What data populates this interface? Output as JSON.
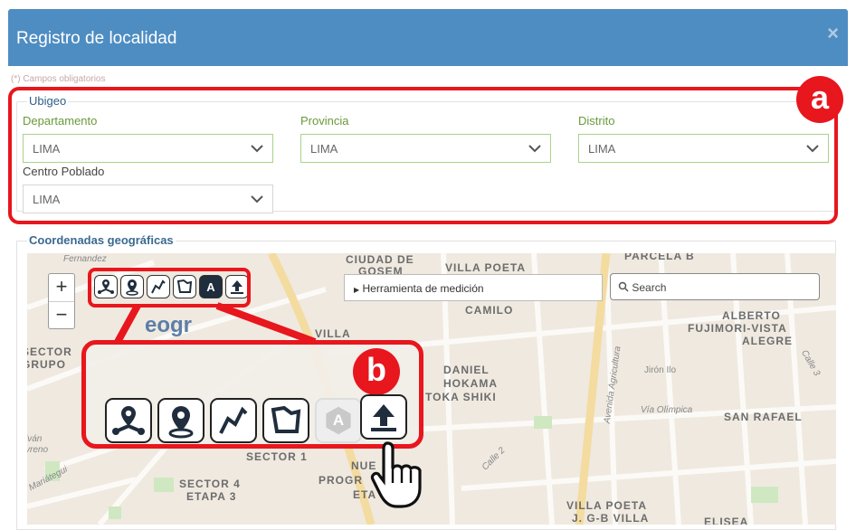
{
  "header": {
    "title": "Registro de localidad",
    "close": "×"
  },
  "required_note": "(*) Campos obligatorios",
  "ubigeo": {
    "legend": "Ubigeo",
    "departamento": {
      "label": "Departamento",
      "value": "LIMA"
    },
    "provincia": {
      "label": "Provincia",
      "value": "LIMA"
    },
    "distrito": {
      "label": "Distrito",
      "value": "LIMA"
    },
    "centro_poblado": {
      "label": "Centro Poblado",
      "value": "LIMA"
    }
  },
  "coords": {
    "legend": "Coordenadas geográficas"
  },
  "map": {
    "zoom_in": "+",
    "zoom_out": "−",
    "measure_label": "Herramienta de medición",
    "search_placeholder": "Search",
    "labels": {
      "fernandez": "Fernandez",
      "ciudad_de": "CIUDAD DE",
      "gosem": "GOSEM",
      "villa_poeta": "VILLA POETA",
      "parcela": "PARCELA B",
      "camilo": "CAMILO",
      "alberto": "ALBERTO",
      "fujimori": "FUJIMORI-VISTA",
      "alegre": "ALEGRE",
      "sector": "SECTOR",
      "grupo": "GRUPO",
      "villa": "VILLA",
      "daniel": "DANIEL",
      "hokama": "HOKAMA",
      "toka": "TOKA SHIKI",
      "av_agricultura": "Avenida Agricultura",
      "jiron_ilo": "Jirón Ilo",
      "calle3": "Calle 3",
      "via_olimpica": "Vía Olímpica",
      "san_rafael": "SAN RAFAEL",
      "sector1": "SECTOR 1",
      "calle2": "Calle 2",
      "mariategui": "Mariátegui",
      "sector4": "SECTOR 4",
      "etapa3": "ETAPA 3",
      "nue": "NUE",
      "progr": "PROGR",
      "eta": "ETA",
      "villa_poeta2": "VILLA POETA",
      "jgb": "J. G-B VILLA",
      "elisea": "ELISEA",
      "geogr": "eogr",
      "ilvan": "lván",
      "vreno": "vreno"
    }
  },
  "toolbar_icons": [
    "pin-route-icon",
    "pin-point-icon",
    "polyline-icon",
    "polygon-icon",
    "label-a-icon",
    "upload-icon"
  ],
  "toolbar_a_letter": "A",
  "annotations": {
    "a": "a",
    "b": "b"
  },
  "colors": {
    "header": "#4e8dc2",
    "annotation": "#e8161d",
    "field_border": "#a8d48a",
    "label_green": "#6a9a3a"
  }
}
